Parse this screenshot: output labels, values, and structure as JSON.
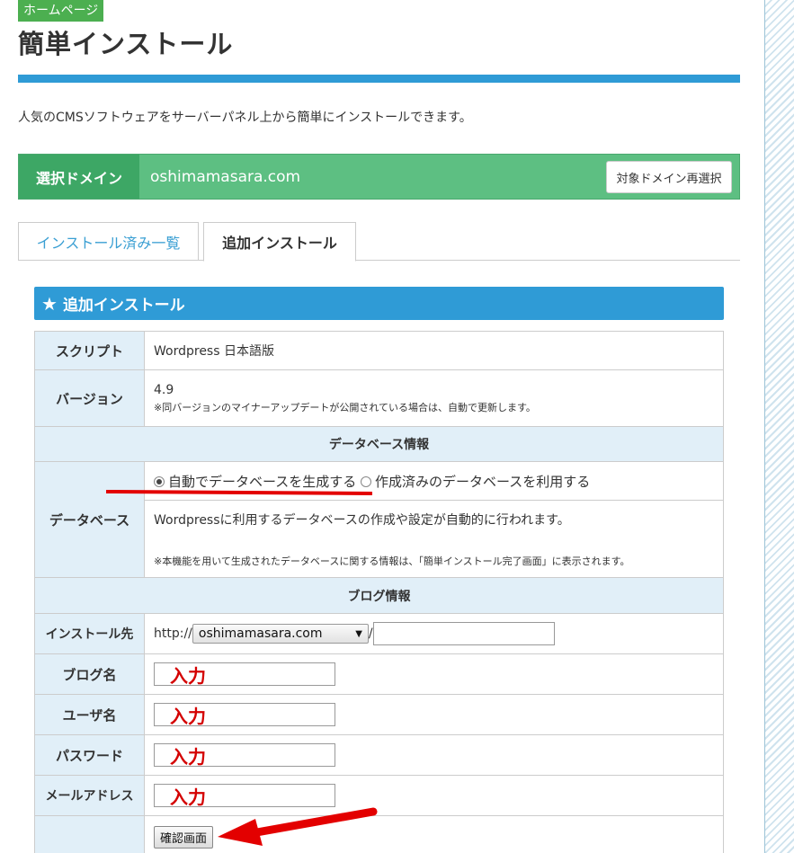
{
  "badge": "ホームページ",
  "page_title": "簡単インストール",
  "intro": "人気のCMSソフトウェアをサーバーパネル上から簡単にインストールできます。",
  "domain": {
    "label": "選択ドメイン",
    "value": "oshimamasara.com",
    "reselect_button": "対象ドメイン再選択"
  },
  "tabs": {
    "installed": "インストール済み一覧",
    "add": "追加インストール"
  },
  "section_title": "追加インストール",
  "form": {
    "script_label": "スクリプト",
    "script_value": "Wordpress 日本語版",
    "version_label": "バージョン",
    "version_value": "4.9",
    "version_note": "※同バージョンのマイナーアップデートが公開されている場合は、自動で更新します。",
    "db_group": "データベース情報",
    "db_label": "データベース",
    "db_option_auto": "自動でデータベースを生成する",
    "db_option_existing": "作成済みのデータベースを利用する",
    "db_desc": "Wordpressに利用するデータベースの作成や設定が自動的に行われます。",
    "db_note": "※本機能を用いて生成されたデータベースに関する情報は、「簡単インストール完了画面」に表示されます。",
    "blog_group": "ブログ情報",
    "install_label": "インストール先",
    "install_prefix": "http://",
    "install_domain": "oshimamasara.com",
    "install_sep": "/",
    "blog_name_label": "ブログ名",
    "user_label": "ユーザ名",
    "password_label": "パスワード",
    "email_label": "メールアドレス",
    "confirm_button": "確認画面"
  },
  "annotations": {
    "input_hint": "入力"
  },
  "colors": {
    "accent_blue": "#2f9bd6",
    "domain_green": "#5dbf82",
    "badge_green": "#4caf50",
    "annotation_red": "#e30000"
  }
}
